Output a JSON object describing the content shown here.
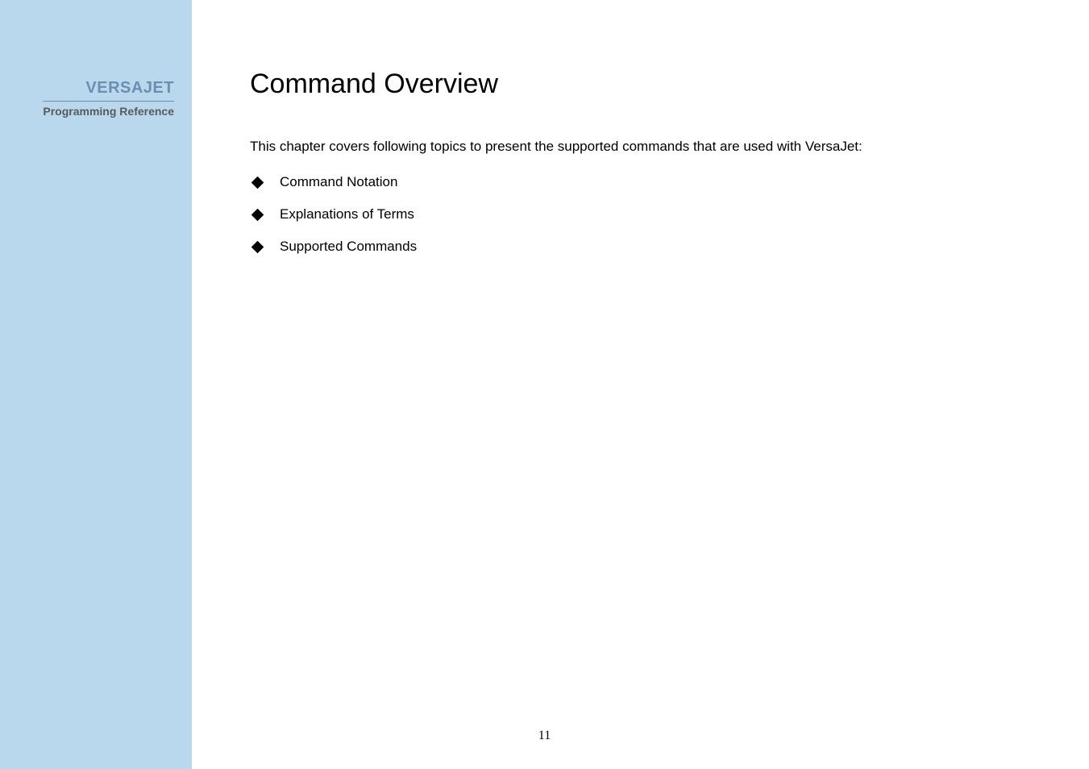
{
  "sidebar": {
    "title": "VERSAJET",
    "subtitle": "Programming Reference"
  },
  "content": {
    "title": "Command Overview",
    "intro": "This chapter covers following topics to present the supported commands that are used with VersaJet:",
    "topics": [
      {
        "text": "Command Notation"
      },
      {
        "text": "Explanations of Terms"
      },
      {
        "text": "Supported Commands"
      }
    ]
  },
  "page_number": "11"
}
